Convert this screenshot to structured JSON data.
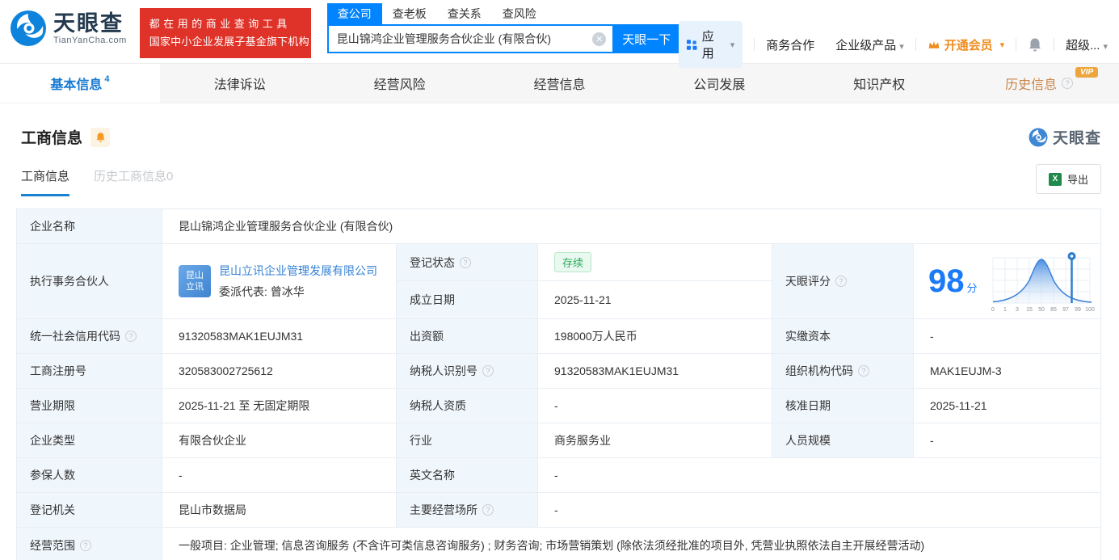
{
  "colors": {
    "accent": "#0084ff",
    "link": "#3482d6",
    "score_blue": "#1a7af8",
    "banner_red": "#df3228",
    "vip_orange": "#eda63e",
    "history_tab_orange": "#c8874b",
    "status_green": "#2bab5d",
    "label_cell_bg": "#f0f7fc"
  },
  "header": {
    "logo_cn": "天眼查",
    "logo_en": "TianYanCha.com",
    "banner_line1": "都在用的商业查询工具",
    "banner_line2": "国家中小企业发展子基金旗下机构",
    "search_tabs": [
      {
        "label": "查公司"
      },
      {
        "label": "查老板"
      },
      {
        "label": "查关系"
      },
      {
        "label": "查风险"
      }
    ],
    "search_value": "昆山锦鸿企业管理服务合伙企业 (有限合伙)",
    "search_button": "天眼一下",
    "nav_apps": "应用",
    "nav_items": [
      "商务合作",
      "企业级产品",
      "开通会员",
      "超级..."
    ]
  },
  "main_tabs": [
    {
      "label": "基本信息",
      "count": "4"
    },
    {
      "label": "法律诉讼"
    },
    {
      "label": "经营风险"
    },
    {
      "label": "经营信息"
    },
    {
      "label": "公司发展"
    },
    {
      "label": "知识产权"
    },
    {
      "label": "历史信息",
      "badge": "VIP"
    }
  ],
  "section": {
    "title": "工商信息",
    "subtab_active": "工商信息",
    "subtab_history": "历史工商信息0",
    "export": "导出",
    "watermark": "天眼查"
  },
  "table": {
    "row1": {
      "label": "企业名称",
      "value": "昆山锦鸿企业管理服务合伙企业 (有限合伙)"
    },
    "partner": {
      "label": "执行事务合伙人",
      "avatar_line1": "昆山",
      "avatar_line2": "立讯",
      "company": "昆山立讯企业管理发展有限公司",
      "representative": "委派代表: 曾冰华"
    },
    "status": {
      "label": "登记状态",
      "value": "存续"
    },
    "established": {
      "label": "成立日期",
      "value": "2025-11-21"
    },
    "score": {
      "label": "天眼评分",
      "value": "98",
      "unit": "分"
    },
    "rows": [
      {
        "c": [
          {
            "label": "统一社会信用代码",
            "value": "91320583MAK1EUJM31"
          },
          {
            "label": "出资额",
            "value": "198000万人民币"
          },
          {
            "label": "实缴资本",
            "value": "-"
          }
        ]
      },
      {
        "c": [
          {
            "label": "工商注册号",
            "value": "320583002725612"
          },
          {
            "label": "纳税人识别号",
            "value": "91320583MAK1EUJM31"
          },
          {
            "label": "组织机构代码",
            "value": "MAK1EUJM-3"
          }
        ]
      },
      {
        "c": [
          {
            "label": "营业期限",
            "value": "2025-11-21 至 无固定期限"
          },
          {
            "label": "纳税人资质",
            "value": "-"
          },
          {
            "label": "核准日期",
            "value": "2025-11-21"
          }
        ]
      },
      {
        "c": [
          {
            "label": "企业类型",
            "value": "有限合伙企业"
          },
          {
            "label": "行业",
            "value": "商务服务业"
          },
          {
            "label": "人员规模",
            "value": "-"
          }
        ]
      },
      {
        "c": [
          {
            "label": "参保人数",
            "value": "-"
          },
          {
            "label": "英文名称",
            "value": "-"
          }
        ]
      },
      {
        "c": [
          {
            "label": "登记机关",
            "value": "昆山市数据局"
          },
          {
            "label": "主要经营场所",
            "value": "-"
          }
        ]
      }
    ],
    "scope": {
      "label": "经营范围",
      "value": "一般项目: 企业管理; 信息咨询服务 (不含许可类信息咨询服务) ; 财务咨询; 市场营销策划 (除依法须经批准的项目外, 凭营业执照依法自主开展经营活动)"
    }
  },
  "chart_data": {
    "type": "area",
    "title": "天眼评分分布曲线",
    "x_ticks": [
      "0",
      "1",
      "3",
      "15",
      "50",
      "85",
      "97",
      "99",
      "100"
    ],
    "marker_value": 98,
    "score": 98,
    "curve_shape": "bell (normal distribution), peak at tick 50",
    "grid": true,
    "legend_position": "none"
  }
}
